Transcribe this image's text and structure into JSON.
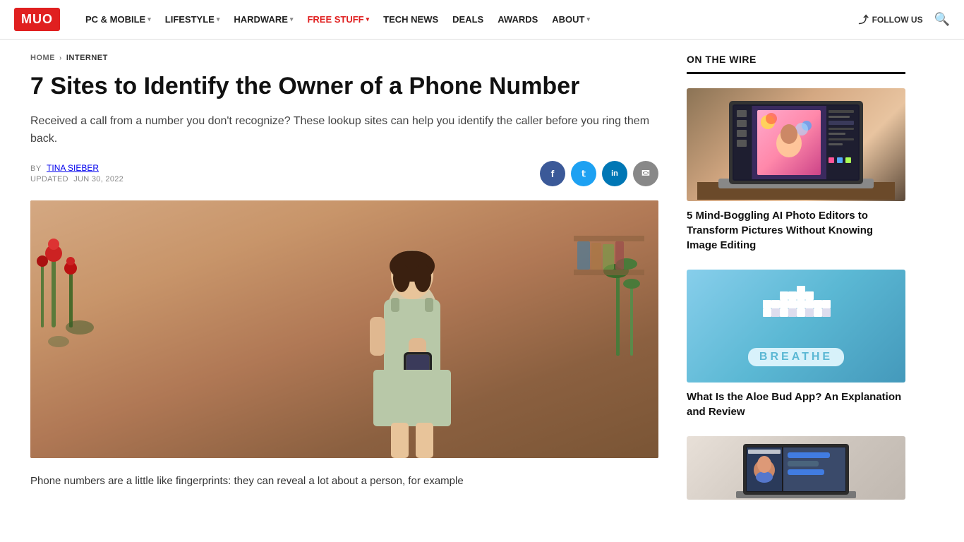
{
  "site": {
    "logo": "MUO",
    "logo_bg": "#e02020"
  },
  "nav": {
    "links": [
      {
        "label": "PC & MOBILE",
        "has_dropdown": true,
        "is_free": false
      },
      {
        "label": "LIFESTYLE",
        "has_dropdown": true,
        "is_free": false
      },
      {
        "label": "HARDWARE",
        "has_dropdown": true,
        "is_free": false
      },
      {
        "label": "FREE STUFF",
        "has_dropdown": true,
        "is_free": true
      },
      {
        "label": "TECH NEWS",
        "has_dropdown": false,
        "is_free": false
      },
      {
        "label": "DEALS",
        "has_dropdown": false,
        "is_free": false
      },
      {
        "label": "AWARDS",
        "has_dropdown": false,
        "is_free": false
      },
      {
        "label": "ABOUT",
        "has_dropdown": true,
        "is_free": false
      }
    ],
    "follow_us": "FOLLOW US",
    "search_placeholder": "Search"
  },
  "breadcrumb": {
    "home": "HOME",
    "section": "INTERNET"
  },
  "article": {
    "title": "7 Sites to Identify the Owner of a Phone Number",
    "subtitle": "Received a call from a number you don't recognize? These lookup sites can help you identify the caller before you ring them back.",
    "author_prefix": "BY",
    "author": "TINA SIEBER",
    "updated_prefix": "UPDATED",
    "updated_date": "JUN 30, 2022",
    "body_start": "Phone numbers are a little like fingerprints: they can reveal a lot about a person, for example"
  },
  "social": {
    "buttons": [
      "f",
      "t",
      "in",
      "✉"
    ]
  },
  "sidebar": {
    "section_title": "ON THE WIRE",
    "cards": [
      {
        "title": "5 Mind-Boggling AI Photo Editors to Transform Pictures Without Knowing Image Editing",
        "type": "laptop"
      },
      {
        "title": "What Is the Aloe Bud App? An Explanation and Review",
        "type": "breathe"
      },
      {
        "title": "",
        "type": "laptop2"
      }
    ]
  }
}
